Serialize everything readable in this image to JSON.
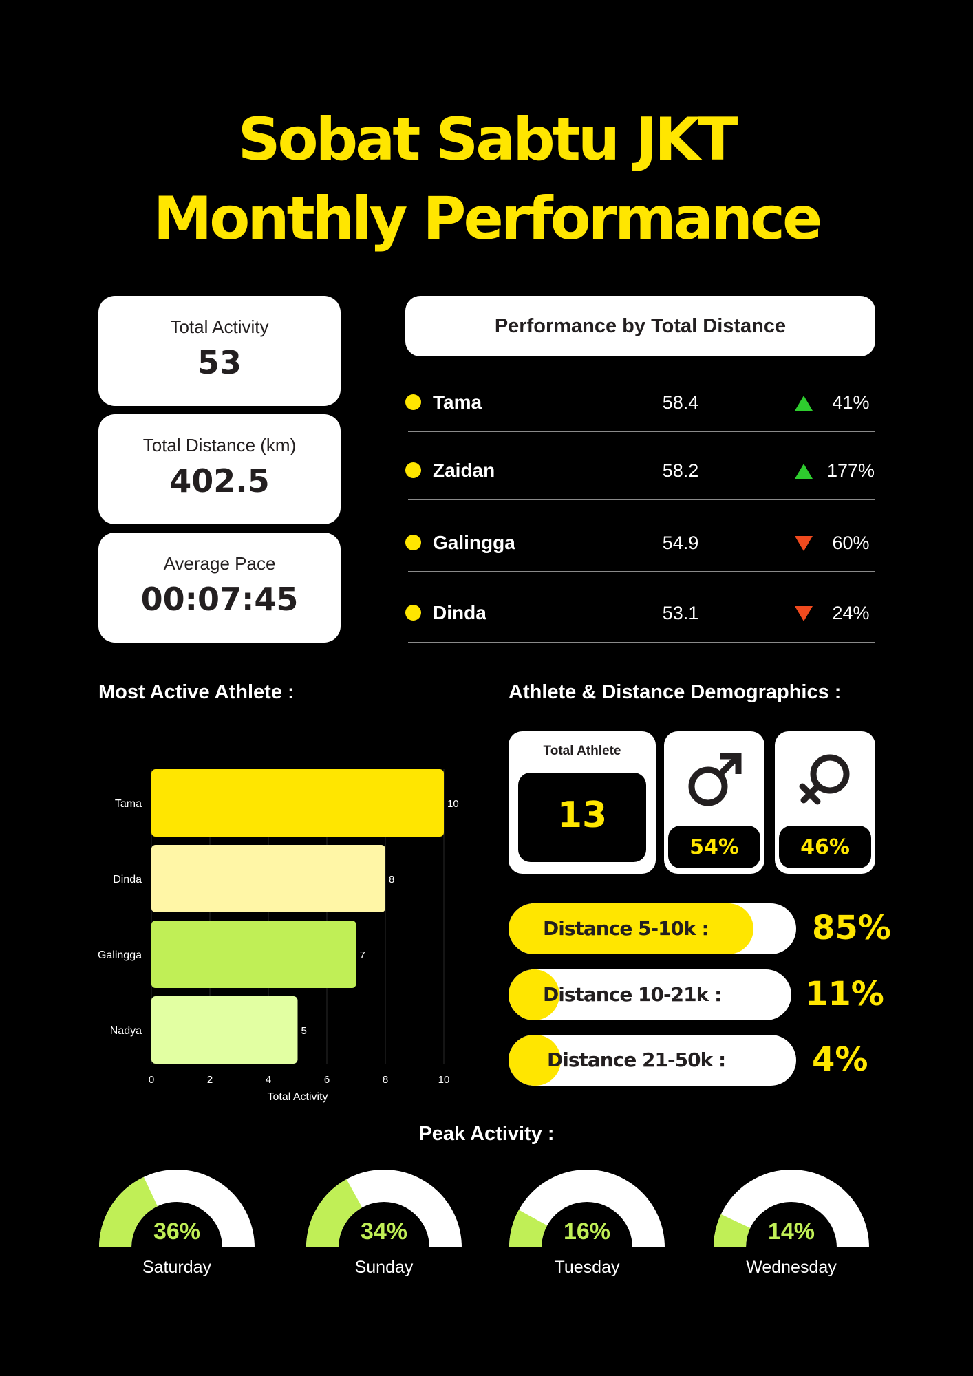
{
  "title": {
    "line1": "Sobat Sabtu JKT",
    "line2": "Monthly Performance"
  },
  "stats": [
    {
      "label": "Total Activity",
      "value": "53"
    },
    {
      "label": "Total Distance (km)",
      "value": "402.5"
    },
    {
      "label": "Average Pace",
      "value": "00:07:45"
    }
  ],
  "performance": {
    "header": "Performance by Total Distance",
    "rows": [
      {
        "name": "Tama",
        "distance": "58.4",
        "trend": "up",
        "pct": "41%"
      },
      {
        "name": "Zaidan",
        "distance": "58.2",
        "trend": "up",
        "pct": "177%"
      },
      {
        "name": "Galingga",
        "distance": "54.9",
        "trend": "down",
        "pct": "60%"
      },
      {
        "name": "Dinda",
        "distance": "53.1",
        "trend": "down",
        "pct": "24%"
      }
    ]
  },
  "most_active": {
    "title": "Most Active Athlete :"
  },
  "demographics": {
    "title": "Athlete & Distance Demographics :",
    "total_label": "Total Athlete",
    "total_value": "13",
    "male_pct": "54%",
    "female_pct": "46%",
    "male_icon": "male-symbol-icon",
    "female_icon": "female-symbol-icon"
  },
  "distance_groups": [
    {
      "label": "Distance 5-10k :",
      "pct": "85%",
      "share": 0.85
    },
    {
      "label": "Distance 10-21k :",
      "pct": "11%",
      "share": 0.11
    },
    {
      "label": "Distance 21-50k :",
      "pct": "4%",
      "share": 0.04
    }
  ],
  "peak_activity": {
    "title": "Peak Activity :",
    "days": [
      {
        "day": "Saturday",
        "pct": "36%",
        "value": 0.36
      },
      {
        "day": "Sunday",
        "pct": "34%",
        "value": 0.34
      },
      {
        "day": "Tuesday",
        "pct": "16%",
        "value": 0.16
      },
      {
        "day": "Wednesday",
        "pct": "14%",
        "value": 0.14
      }
    ]
  },
  "colors": {
    "accent_yellow": "#ffe600",
    "trend_up": "#2ecc2e",
    "trend_down": "#f04a1e",
    "gauge_green": "#c0ef56",
    "bar_colors": [
      "#ffe600",
      "#fff6a6",
      "#c0ef56",
      "#e2ffa2"
    ]
  },
  "chart_data": {
    "type": "bar",
    "orientation": "horizontal",
    "categories": [
      "Tama",
      "Dinda",
      "Galingga",
      "Nadya"
    ],
    "values": [
      10,
      8,
      7,
      5
    ],
    "title": "",
    "xlabel": "Total Activity",
    "ylabel": "",
    "xlim": [
      0,
      10
    ],
    "xticks": [
      0,
      2,
      4,
      6,
      8,
      10
    ],
    "grid": true
  }
}
